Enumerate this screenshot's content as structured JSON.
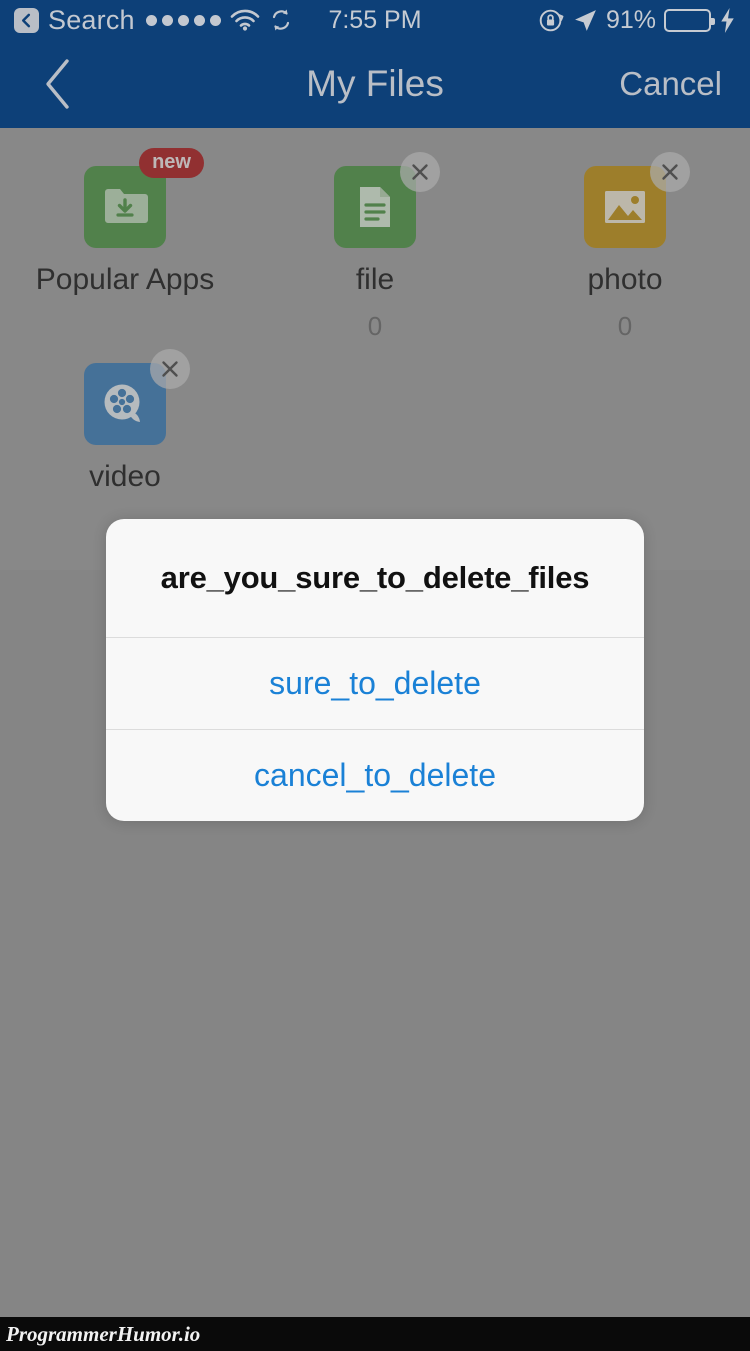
{
  "statusbar": {
    "back_label": "Search",
    "signal_dots": 5,
    "wifi_icon": "wifi-icon",
    "sync_icon": "sync-icon",
    "time": "7:55 PM",
    "rotation_lock_icon": "rotation-lock-icon",
    "location_icon": "location-arrow-icon",
    "battery_percent": "91%",
    "battery_level": 91,
    "charging_icon": "lightning-bolt-icon",
    "battery_color": "#2f9c3f",
    "bar_color": "#0d4078"
  },
  "navbar": {
    "back_icon": "chevron-left-icon",
    "title": "My Files",
    "cancel_label": "Cancel"
  },
  "files": [
    {
      "label": "Popular Apps",
      "count": "",
      "icon": "folder-download-icon",
      "color": "#4e9246",
      "color_class": "green",
      "badge_type": "new",
      "badge_label": "new",
      "badge_color": "#aa1f20"
    },
    {
      "label": "file",
      "count": "0",
      "icon": "document-icon",
      "color": "#4e9246",
      "color_class": "green",
      "badge_type": "close",
      "badge_label": "",
      "badge_color": "#cecece"
    },
    {
      "label": "photo",
      "count": "0",
      "icon": "image-icon",
      "color": "#bb8f18",
      "color_class": "amber",
      "badge_type": "close",
      "badge_label": "",
      "badge_color": "#cecece"
    },
    {
      "label": "video",
      "count": "",
      "icon": "film-reel-icon",
      "color": "#3d7cb4",
      "color_class": "blue",
      "badge_type": "close",
      "badge_label": "",
      "badge_color": "#cecece"
    }
  ],
  "alert": {
    "title": "are_you_sure_to_delete_files",
    "confirm_label": "sure_to_delete",
    "cancel_label": "cancel_to_delete",
    "link_color": "#1a81d6"
  },
  "footer": {
    "watermark": "ProgrammerHumor.io"
  }
}
